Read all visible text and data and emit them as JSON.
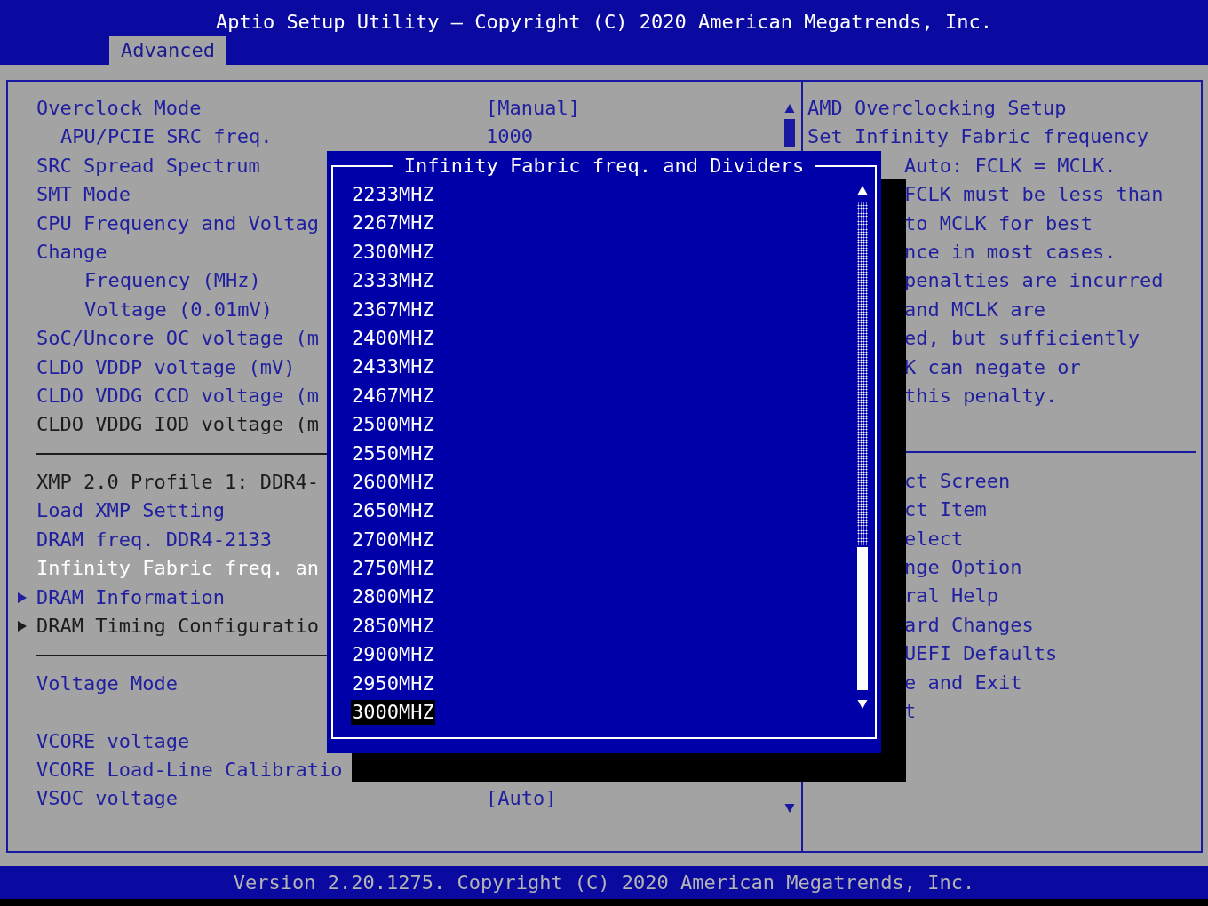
{
  "header": {
    "title": "Aptio Setup Utility – Copyright (C) 2020 American Megatrends, Inc.",
    "tabs": [
      {
        "label": "Advanced",
        "selected": true
      }
    ]
  },
  "settings": [
    {
      "kind": "item",
      "label": "Overclock Mode",
      "value": "[Manual]",
      "disabled": false,
      "selected": false,
      "children": [
        {
          "kind": "setting",
          "label": "APU/PCIE SRC freq.",
          "value": "1000",
          "disabled": false,
          "selected": false
        }
      ]
    },
    {
      "kind": "item",
      "label": "SRC Spread Spectrum",
      "disabled": false,
      "selected": false
    },
    {
      "kind": "item",
      "label": "SMT Mode",
      "disabled": false,
      "selected": false
    },
    {
      "kind": "item",
      "label": "CPU Frequency and Voltag",
      "disabled": false,
      "selected": false
    },
    {
      "kind": "item",
      "label": "Change",
      "disabled": false,
      "selected": false,
      "children": [
        {
          "kind": "field",
          "label": "Frequency (MHz)",
          "disabled": false,
          "selected": false
        },
        {
          "kind": "field",
          "label": "Voltage (0.01mV)",
          "disabled": false,
          "selected": false
        }
      ]
    },
    {
      "kind": "item",
      "label": "SoC/Uncore OC voltage (m",
      "disabled": false,
      "selected": false
    },
    {
      "kind": "item",
      "label": "CLDO VDDP voltage (mV)",
      "disabled": false,
      "selected": false
    },
    {
      "kind": "item",
      "label": "CLDO VDDG CCD voltage (m",
      "disabled": false,
      "selected": false
    },
    {
      "kind": "item",
      "label": "CLDO VDDG IOD voltage (m",
      "disabled": true,
      "selected": false
    },
    {
      "kind": "separator"
    },
    {
      "kind": "item",
      "label": "XMP 2.0 Profile 1: DDR4-",
      "disabled": true,
      "selected": false
    },
    {
      "kind": "item",
      "label": "Load XMP Setting",
      "disabled": false,
      "selected": false
    },
    {
      "kind": "item",
      "label": "DRAM freq. DDR4-2133",
      "disabled": false,
      "selected": false
    },
    {
      "kind": "item",
      "label": "Infinity Fabric freq. an",
      "selected": true
    },
    {
      "kind": "item",
      "label": "DRAM Information",
      "disabled": false,
      "selected": false,
      "submenu": true
    },
    {
      "kind": "item",
      "label": "DRAM Timing Configuratio",
      "disabled": true,
      "selected": false,
      "submenu": true
    },
    {
      "kind": "separator"
    },
    {
      "kind": "item",
      "label": "Voltage Mode",
      "disabled": false,
      "selected": false
    },
    {
      "kind": "blank"
    },
    {
      "kind": "item",
      "label": "VCORE voltage",
      "disabled": false,
      "selected": false
    },
    {
      "kind": "item",
      "label": "VCORE Load-Line Calibratio",
      "disabled": false,
      "selected": false
    },
    {
      "kind": "item",
      "label": "VSOC voltage",
      "value": "[Auto]",
      "disabled": false,
      "selected": false
    }
  ],
  "popup": {
    "title": "Infinity Fabric freq. and Dividers",
    "options": [
      {
        "label": "2233MHZ",
        "selected": false
      },
      {
        "label": "2267MHZ",
        "selected": false
      },
      {
        "label": "2300MHZ",
        "selected": false
      },
      {
        "label": "2333MHZ",
        "selected": false
      },
      {
        "label": "2367MHZ",
        "selected": false
      },
      {
        "label": "2400MHZ",
        "selected": false
      },
      {
        "label": "2433MHZ",
        "selected": false
      },
      {
        "label": "2467MHZ",
        "selected": false
      },
      {
        "label": "2500MHZ",
        "selected": false
      },
      {
        "label": "2550MHZ",
        "selected": false
      },
      {
        "label": "2600MHZ",
        "selected": false
      },
      {
        "label": "2650MHZ",
        "selected": false
      },
      {
        "label": "2700MHZ",
        "selected": false
      },
      {
        "label": "2750MHZ",
        "selected": false
      },
      {
        "label": "2800MHZ",
        "selected": false
      },
      {
        "label": "2850MHZ",
        "selected": false
      },
      {
        "label": "2900MHZ",
        "selected": false
      },
      {
        "label": "2950MHZ",
        "selected": false
      },
      {
        "label": "3000MHZ",
        "selected": true
      }
    ]
  },
  "help": {
    "lines": [
      {
        "text": "AMD Overclocking Setup",
        "clipped": false
      },
      {
        "text": "Set Infinity Fabric frequency",
        "clipped": false
      },
      {
        "text": "Auto: FCLK = MCLK.",
        "clipped": true
      },
      {
        "text": "FCLK must be less than",
        "clipped": true
      },
      {
        "text": "to MCLK for best",
        "clipped": true
      },
      {
        "text": "nce in most cases.",
        "clipped": true
      },
      {
        "text": "penalties are incurred",
        "clipped": true
      },
      {
        "text": "and MCLK are",
        "clipped": true
      },
      {
        "text": "ed, but sufficiently",
        "clipped": true
      },
      {
        "text": "K can negate or",
        "clipped": true
      },
      {
        "text": "this penalty.",
        "clipped": true
      }
    ],
    "keys": [
      {
        "text": "ct Screen",
        "clipped": true
      },
      {
        "text": "ct Item",
        "clipped": true
      },
      {
        "text": "elect",
        "clipped": true
      },
      {
        "text": "nge Option",
        "clipped": true
      },
      {
        "text": "ral Help",
        "clipped": true
      },
      {
        "text": "ard Changes",
        "clipped": true
      },
      {
        "text": "UEFI Defaults",
        "clipped": true
      },
      {
        "text": "e and Exit",
        "clipped": true
      },
      {
        "text": "t",
        "clipped": true
      }
    ]
  },
  "footer": {
    "text": "Version 2.20.1275. Copyright (C) 2020 American Megatrends, Inc."
  }
}
